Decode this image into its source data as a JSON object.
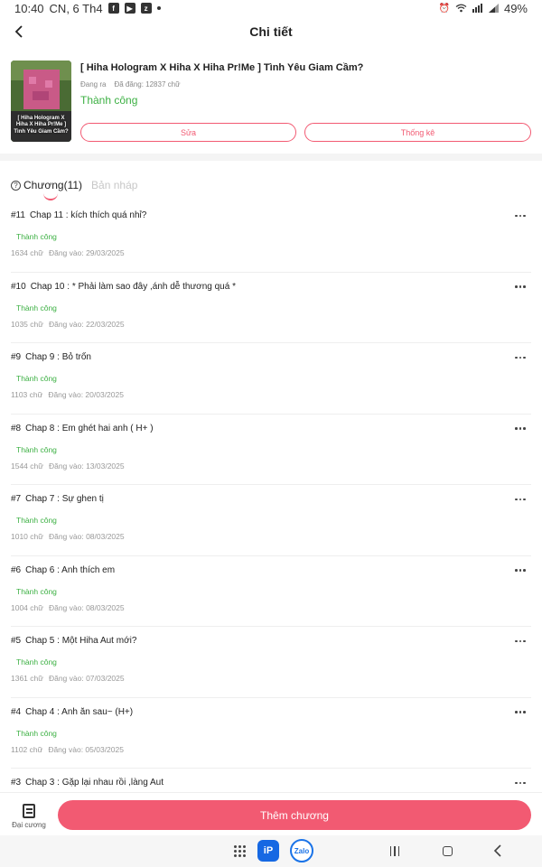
{
  "status_bar": {
    "time": "10:40",
    "date": "CN, 6 Th4",
    "battery": "49%"
  },
  "header": {
    "title": "Chi tiết"
  },
  "story": {
    "cover_text": "[ Hiha Hologram X Hiha X Hiha Pr!Me ] Tình Yêu Giam Cầm?",
    "title": "[ Hiha Hologram X Hiha X Hiha Pr!Me ] Tình Yêu Giam Cầm?",
    "state": "Đang ra",
    "published": "Đã đăng: 12837 chữ",
    "status": "Thành công",
    "edit_label": "Sửa",
    "stats_label": "Thống kê"
  },
  "tabs": {
    "chapters_label": "Chương(11)",
    "drafts_label": "Bản nháp"
  },
  "chapters": [
    {
      "num": "#11",
      "title": "Chap 11 : kích thích quá nhỉ?",
      "status": "Thành công",
      "words": "1634 chữ",
      "date": "Đăng vào:  29/03/2025"
    },
    {
      "num": "#10",
      "title": "Chap 10 : * Phải làm sao đây ,ánh dễ thương quá *",
      "status": "Thành công",
      "words": "1035 chữ",
      "date": "Đăng vào:  22/03/2025"
    },
    {
      "num": "#9",
      "title": "Chap 9 : Bỏ trốn",
      "status": "Thành công",
      "words": "1103 chữ",
      "date": "Đăng vào:  20/03/2025"
    },
    {
      "num": "#8",
      "title": "Chap 8 : Em ghét hai anh ( H+ )",
      "status": "Thành công",
      "words": "1544 chữ",
      "date": "Đăng vào:  13/03/2025"
    },
    {
      "num": "#7",
      "title": "Chap 7 : Sự ghen tị",
      "status": "Thành công",
      "words": "1010 chữ",
      "date": "Đăng vào:  08/03/2025"
    },
    {
      "num": "#6",
      "title": "Chap 6 : Anh thích em",
      "status": "Thành công",
      "words": "1004 chữ",
      "date": "Đăng vào:  08/03/2025"
    },
    {
      "num": "#5",
      "title": "Chap 5 : Một Hiha Aut mới?",
      "status": "Thành công",
      "words": "1361 chữ",
      "date": "Đăng vào:  07/03/2025"
    },
    {
      "num": "#4",
      "title": "Chap 4 : Anh ăn sau~ (H+)",
      "status": "Thành công",
      "words": "1102 chữ",
      "date": "Đăng vào:  05/03/2025"
    },
    {
      "num": "#3",
      "title": "Chap 3 : Gặp lại nhau rồi ,làng Aut",
      "status": "",
      "words": "",
      "date": ""
    }
  ],
  "bottom": {
    "outline_label": "Đại cương",
    "add_label": "Thêm chương"
  },
  "nav": {
    "ip_label": "iP",
    "zalo_label": "Zalo"
  },
  "colors": {
    "accent": "#f25a72",
    "success": "#3cb043"
  }
}
